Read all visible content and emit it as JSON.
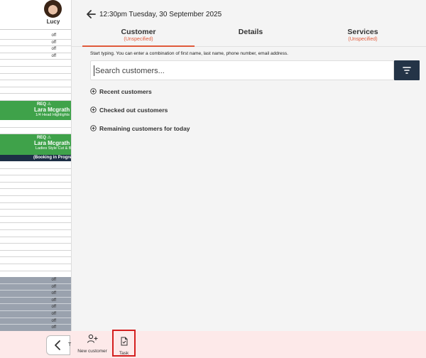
{
  "staff": {
    "name": "Lucy"
  },
  "slots_top": [
    "off",
    "off",
    "off",
    "off"
  ],
  "appointments": [
    {
      "req": "REQ ⚠",
      "name": "Lara Mcgrath",
      "service": "1/4 Head Highlights"
    },
    {
      "req": "REQ ⚠",
      "name": "Lara Mcgrath",
      "service": "Ladies Style Cut & Blow"
    }
  ],
  "in_progress_label": "(Booking in Progre",
  "slots_bottom": [
    "off",
    "off",
    "off",
    "off",
    "off",
    "off",
    "off",
    "off"
  ],
  "header": {
    "title": "12:30pm Tuesday, 30 September 2025"
  },
  "tabs": [
    {
      "label": "Customer",
      "sub": "(Unspecified)"
    },
    {
      "label": "Details",
      "sub": ""
    },
    {
      "label": "Services",
      "sub": "(Unspecified)"
    }
  ],
  "hint": "Start typing. You can enter a combination of first name, last name, phone number, email address.",
  "search": {
    "placeholder": "Search customers..."
  },
  "sections": [
    "Recent customers",
    "Checked out customers",
    "Remaining customers for today"
  ],
  "bottom": {
    "nav_text": "T",
    "new_customer": "New customer",
    "task": "Task"
  },
  "colors": {
    "accent": "#e05a3a",
    "appointment": "#3fa24a",
    "navy": "#243447",
    "highlight": "#d41f1f"
  }
}
